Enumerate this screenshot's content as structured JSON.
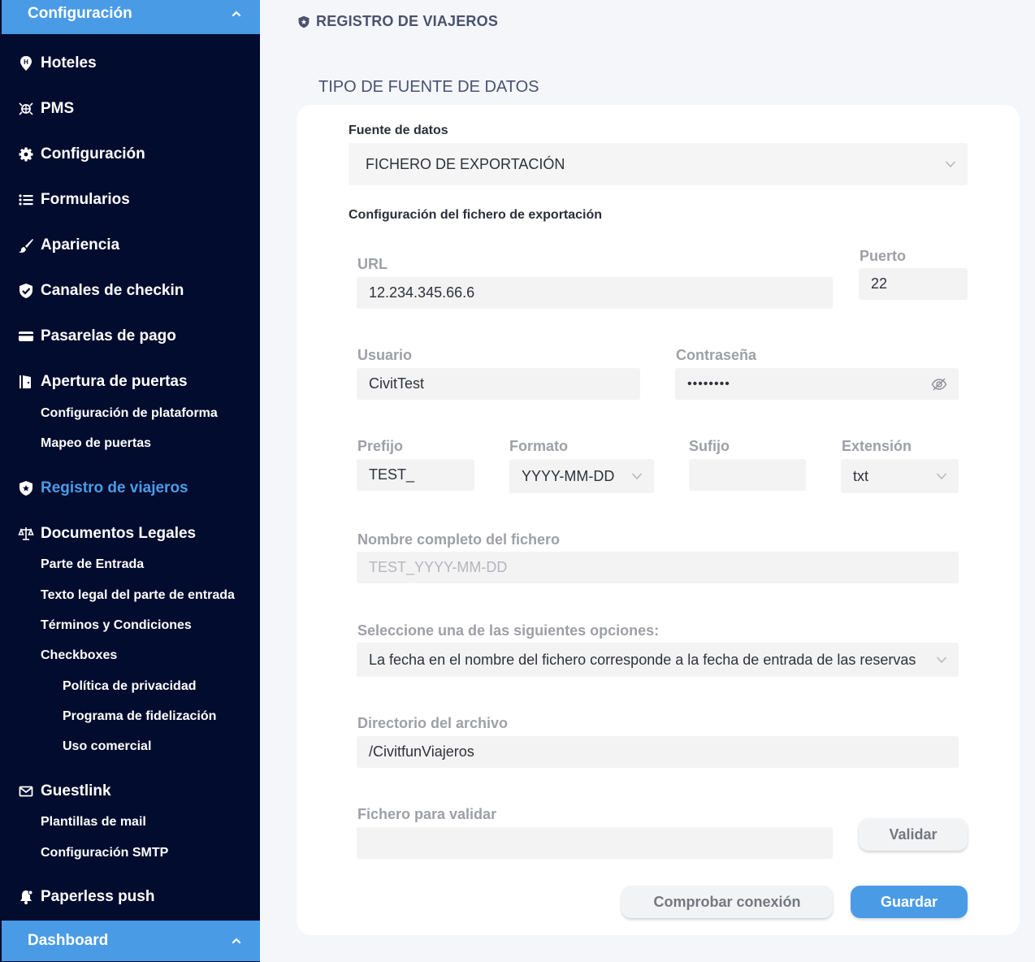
{
  "sidebar": {
    "top_header": "Configuración",
    "bottom_header": "Dashboard",
    "items": {
      "hoteles": "Hoteles",
      "pms": "PMS",
      "configuracion": "Configuración",
      "formularios": "Formularios",
      "apariencia": "Apariencia",
      "canales": "Canales de checkin",
      "pasarelas": "Pasarelas de pago",
      "apertura": "Apertura de puertas",
      "config_plataforma": "Configuración de plataforma",
      "mapeo_puertas": "Mapeo de puertas",
      "registro": "Registro de viajeros",
      "documentos": "Documentos Legales",
      "parte_entrada": "Parte de Entrada",
      "texto_legal": "Texto legal del parte de entrada",
      "terminos": "Términos y Condiciones",
      "checkboxes": "Checkboxes",
      "privacidad": "Política de privacidad",
      "fidelizacion": "Programa de fidelización",
      "uso_comercial": "Uso comercial",
      "guestlink": "Guestlink",
      "plantillas": "Plantillas de mail",
      "smtp": "Configuración SMTP",
      "paperless": "Paperless push"
    }
  },
  "page": {
    "title": "REGISTRO DE VIAJEROS",
    "section_title": "TIPO DE FUENTE DE DATOS"
  },
  "form": {
    "source_label": "Fuente de datos",
    "source_value": "FICHERO DE EXPORTACIÓN",
    "export_config_label": "Configuración del fichero de exportación",
    "url_label": "URL",
    "url_value": "12.234.345.66.6",
    "port_label": "Puerto",
    "port_value": "22",
    "user_label": "Usuario",
    "user_value": "CivitTest",
    "password_label": "Contraseña",
    "password_value": "••••••••",
    "prefix_label": "Prefijo",
    "prefix_value": "TEST_",
    "format_label": "Formato",
    "format_value": "YYYY-MM-DD",
    "suffix_label": "Sufijo",
    "suffix_value": "",
    "extension_label": "Extensión",
    "extension_value": "txt",
    "fullname_label": "Nombre completo del fichero",
    "fullname_value": "TEST_YYYY-MM-DD",
    "options_label": "Seleccione una de las siguientes opciones:",
    "options_value": "La fecha en el nombre del fichero corresponde a la fecha de entrada de las reservas",
    "directory_label": "Directorio del archivo",
    "directory_value": "/CivitfunViajeros",
    "validate_file_label": "Fichero para validar",
    "validate_file_value": "",
    "validate_button": "Validar",
    "check_connection_button": "Comprobar conexión",
    "save_button": "Guardar"
  }
}
